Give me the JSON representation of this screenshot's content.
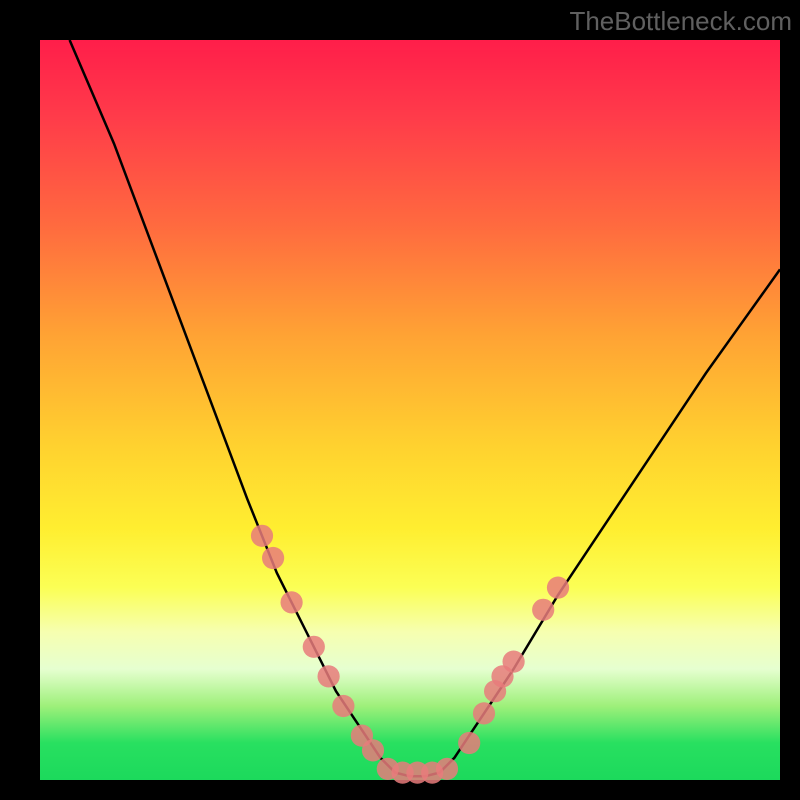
{
  "watermark": "TheBottleneck.com",
  "chart_data": {
    "type": "line",
    "title": "",
    "xlabel": "",
    "ylabel": "",
    "xlim": [
      0,
      100
    ],
    "ylim": [
      0,
      100
    ],
    "grid": false,
    "legend": false,
    "series": [
      {
        "name": "bottleneck-curve-left",
        "x": [
          4,
          7,
          10,
          13,
          16,
          19,
          22,
          25,
          28,
          30,
          32,
          34,
          36,
          38,
          40,
          42,
          44,
          46,
          48
        ],
        "values": [
          100,
          93,
          86,
          78,
          70,
          62,
          54,
          46,
          38,
          33,
          28,
          24,
          20,
          16,
          12,
          9,
          6,
          3,
          1
        ]
      },
      {
        "name": "bottleneck-curve-trough",
        "x": [
          48,
          50,
          52,
          54
        ],
        "values": [
          1,
          0.5,
          0.5,
          1
        ]
      },
      {
        "name": "bottleneck-curve-right",
        "x": [
          54,
          56,
          58,
          60,
          62,
          64,
          67,
          70,
          74,
          78,
          82,
          86,
          90,
          95,
          100
        ],
        "values": [
          1,
          3,
          6,
          9,
          12,
          15,
          20,
          25,
          31,
          37,
          43,
          49,
          55,
          62,
          69
        ]
      }
    ],
    "markers": [
      {
        "name": "left-marker",
        "x": 30.0,
        "y": 33
      },
      {
        "name": "left-marker",
        "x": 31.5,
        "y": 30
      },
      {
        "name": "left-marker",
        "x": 34.0,
        "y": 24
      },
      {
        "name": "left-marker",
        "x": 37.0,
        "y": 18
      },
      {
        "name": "left-marker",
        "x": 39.0,
        "y": 14
      },
      {
        "name": "left-marker",
        "x": 41.0,
        "y": 10
      },
      {
        "name": "left-marker",
        "x": 43.5,
        "y": 6
      },
      {
        "name": "left-marker",
        "x": 45.0,
        "y": 4
      },
      {
        "name": "trough-marker",
        "x": 47.0,
        "y": 1.5
      },
      {
        "name": "trough-marker",
        "x": 49.0,
        "y": 1
      },
      {
        "name": "trough-marker",
        "x": 51.0,
        "y": 1
      },
      {
        "name": "trough-marker",
        "x": 53.0,
        "y": 1
      },
      {
        "name": "trough-marker",
        "x": 55.0,
        "y": 1.5
      },
      {
        "name": "right-marker",
        "x": 58.0,
        "y": 5
      },
      {
        "name": "right-marker",
        "x": 60.0,
        "y": 9
      },
      {
        "name": "right-marker",
        "x": 61.5,
        "y": 12
      },
      {
        "name": "right-marker",
        "x": 62.5,
        "y": 14
      },
      {
        "name": "right-marker",
        "x": 64.0,
        "y": 16
      },
      {
        "name": "right-marker",
        "x": 68.0,
        "y": 23
      },
      {
        "name": "right-marker",
        "x": 70.0,
        "y": 26
      }
    ],
    "marker_style": {
      "radius_pct": 1.5,
      "fill": "#e77b7b",
      "opacity": 0.85
    }
  }
}
